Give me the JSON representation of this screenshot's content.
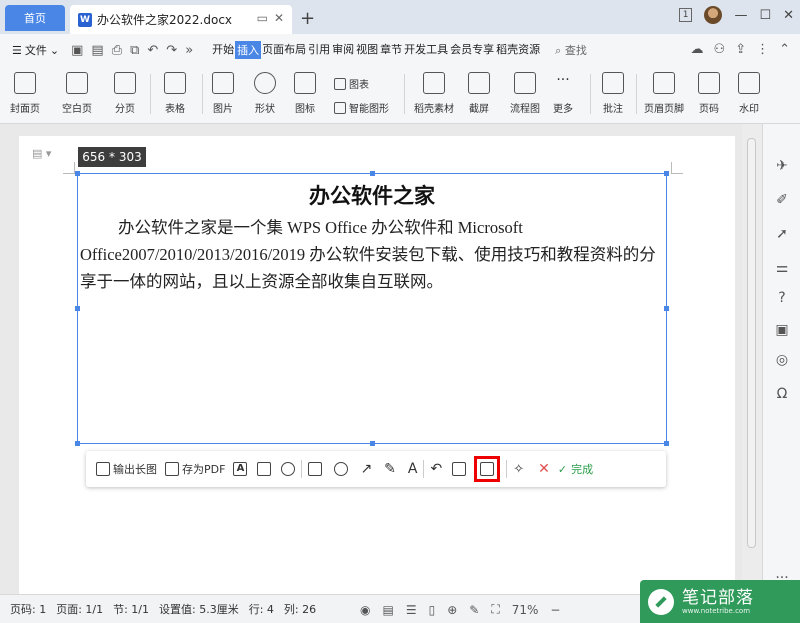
{
  "titlebar": {
    "home_tab": "首页",
    "doc_tab": "办公软件之家2022.docx",
    "doc_icon": "W",
    "page_badge": "1"
  },
  "menubar": {
    "file": "文件",
    "tabs": [
      "开始",
      "插入",
      "页面布局",
      "引用",
      "审阅",
      "视图",
      "章节",
      "开发工具",
      "会员专享",
      "稻壳资源"
    ],
    "active_tab": "插入",
    "search": "查找"
  },
  "ribbon": {
    "cover": "封面页",
    "blank": "空白页",
    "pagebreak": "分页",
    "table": "表格",
    "picture": "图片",
    "shape": "形状",
    "icon": "图标",
    "chart": "图表",
    "smartart": "智能图形",
    "docer": "稻壳素材",
    "screenshot": "截屏",
    "flowchart": "流程图",
    "more": "更多",
    "comment": "批注",
    "header_footer": "页眉页脚",
    "page_number": "页码",
    "watermark": "水印"
  },
  "selection": {
    "size": "656 * 303",
    "title": "办公软件之家",
    "body": "办公软件之家是一个集 WPS Office 办公软件和 Microsoft Office2007/2010/2013/2016/2019 办公软件安装包下载、使用技巧和教程资料的分享于一体的网站，且以上资源全部收集自互联网。"
  },
  "shot_toolbar": {
    "long_image": "输出长图",
    "save_pdf": "存为PDF",
    "text_tool": "A",
    "done": "完成"
  },
  "statusbar": {
    "page_code": "页码: 1",
    "pages": "页面: 1/1",
    "section": "节: 1/1",
    "setting": "设置值: 5.3厘米",
    "row": "行: 4",
    "col": "列: 26",
    "zoom": "71%"
  },
  "watermark": {
    "text": "笔记部落",
    "url": "www.notetribe.com"
  },
  "colors": {
    "accent": "#4a86e6",
    "highlight": "#e00000",
    "done": "#2a9d4a"
  }
}
